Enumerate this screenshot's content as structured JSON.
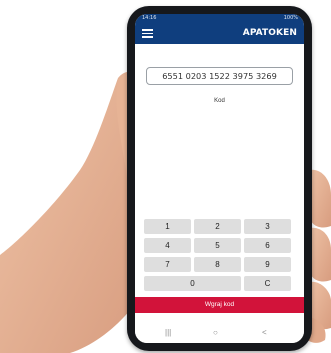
{
  "status_bar": {
    "time": "14:16",
    "right": "100%"
  },
  "app_bar": {
    "brand": "APATOKEN",
    "menu_icon": "hamburger-menu-icon"
  },
  "code_field": {
    "value": "6551 0203 1522 3975 3269",
    "label": "Kod"
  },
  "keypad": {
    "keys": [
      "1",
      "2",
      "3",
      "4",
      "5",
      "6",
      "7",
      "8",
      "9",
      "0",
      "C"
    ]
  },
  "submit_button": {
    "label": "Wgraj kod",
    "color": "#d2133a"
  },
  "nav_bar": {
    "recents": "|||",
    "home": "○",
    "back": "<"
  },
  "colors": {
    "app_bar": "#0f3e7e",
    "key_bg": "#dedede"
  }
}
